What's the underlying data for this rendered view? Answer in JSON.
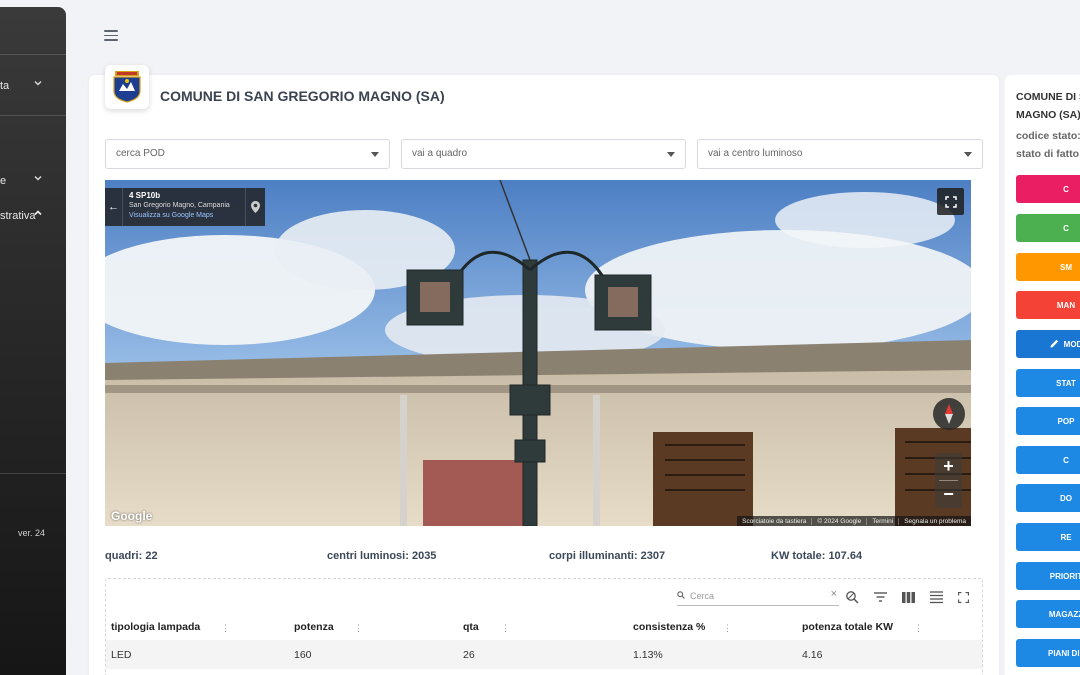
{
  "sidebar": {
    "items": [
      {
        "label": "ta"
      },
      {
        "label": "e"
      },
      {
        "label": "strativa"
      }
    ],
    "version": "ver. 24"
  },
  "header": {
    "title": "COMUNE DI SAN GREGORIO MAGNO (SA)"
  },
  "filters": {
    "pod_placeholder": "cerca POD",
    "quadro_placeholder": "vai a quadro",
    "centro_placeholder": "vai a centro luminoso"
  },
  "streetview": {
    "title": "4 SP10b",
    "subtitle": "San Gregorio Magno, Campania",
    "link": "Visualizza su Google Maps",
    "google": "Google",
    "footer": [
      "Scorciatoie da tastiera",
      "© 2024 Google",
      "Termini",
      "Segnala un problema"
    ],
    "zoom_in": "+",
    "zoom_out": "−"
  },
  "stats": {
    "quadri": "quadri: 22",
    "centri": "centri luminosi: 2035",
    "corpi": "corpi illuminanti: 2307",
    "kw": "KW totale: 107.64"
  },
  "table": {
    "search_placeholder": "Cerca",
    "columns": [
      "tipologia lampada",
      "potenza",
      "qta",
      "consistenza %",
      "potenza totale KW"
    ],
    "rows": [
      [
        "LED",
        "160",
        "26",
        "1.13%",
        "4.16"
      ]
    ]
  },
  "right_panel": {
    "title_line1": "COMUNE DI S",
    "title_line2": "MAGNO (SA)",
    "codice": "codice stato:",
    "stato": "stato di fatto",
    "buttons": [
      {
        "label": "C",
        "color": "#e91e63"
      },
      {
        "label": "C",
        "color": "#4caf50"
      },
      {
        "label": "SM",
        "color": "#ff9800"
      },
      {
        "label": "MAN",
        "color": "#f44336"
      },
      {
        "label": "MOD",
        "color": "#1976d2"
      },
      {
        "label": "STAT",
        "color": "#1e88e5"
      },
      {
        "label": "POP",
        "color": "#1e88e5"
      },
      {
        "label": "C",
        "color": "#1e88e5"
      },
      {
        "label": "DO",
        "color": "#1e88e5"
      },
      {
        "label": "RE",
        "color": "#1e88e5"
      },
      {
        "label": "PRIORIT",
        "color": "#1e88e5"
      },
      {
        "label": "MAGAZZ",
        "color": "#1e88e5"
      },
      {
        "label": "PIANI DI I",
        "color": "#1e88e5"
      }
    ]
  }
}
